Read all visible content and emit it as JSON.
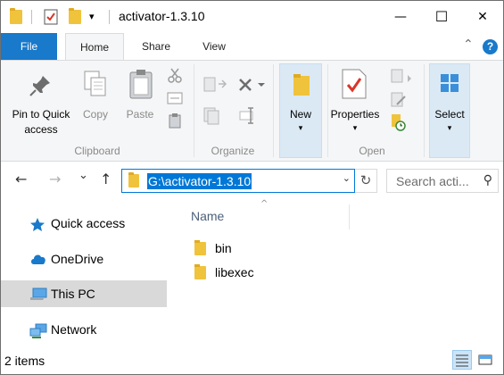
{
  "window": {
    "title": "activator-1.3.10"
  },
  "titlebar": {
    "qa_dropdown_glyph": "▾",
    "minimize_glyph": "—",
    "maximize_glyph": "☐",
    "close_glyph": "✕"
  },
  "tabs": {
    "file": "File",
    "items": [
      "Home",
      "Share",
      "View"
    ],
    "active": "Home",
    "collapse_glyph": "⌃",
    "help_glyph": "?"
  },
  "ribbon": {
    "clipboard": {
      "pin_label_1": "Pin to Quick",
      "pin_label_2": "access",
      "copy_label": "Copy",
      "paste_label": "Paste",
      "group_label": "Clipboard"
    },
    "organize": {
      "group_label": "Organize"
    },
    "new": {
      "new_label": "New",
      "new_caret": "▾"
    },
    "open": {
      "properties_label": "Properties",
      "properties_caret": "▾",
      "group_label": "Open"
    },
    "select": {
      "select_label": "Select",
      "select_caret": "▾"
    }
  },
  "navigation": {
    "back_glyph": "←",
    "forward_glyph": "→",
    "recent_glyph": "⌄",
    "up_glyph": "↑",
    "address": "G:\\activator-1.3.10",
    "address_dropdown": "⌄",
    "refresh_glyph": "↻",
    "search_placeholder": "Search acti...",
    "search_glyph": "⚲"
  },
  "nav_pane": {
    "items": [
      {
        "label": "Quick access",
        "icon": "star-icon"
      },
      {
        "label": "OneDrive",
        "icon": "cloud-icon"
      },
      {
        "label": "This PC",
        "icon": "computer-icon",
        "selected": true
      },
      {
        "label": "Network",
        "icon": "network-icon"
      }
    ]
  },
  "content": {
    "column_name": "Name",
    "sort_glyph": "^",
    "files": [
      {
        "name": "bin",
        "icon": "folder-icon"
      },
      {
        "name": "libexec",
        "icon": "folder-icon"
      }
    ]
  },
  "status": {
    "items_text": "2 items",
    "view_mode": "details"
  },
  "colors": {
    "accent": "#1979ca",
    "selection": "#0078d7",
    "folder": "#f0c33c",
    "nav_selected": "#d9d9d9"
  }
}
